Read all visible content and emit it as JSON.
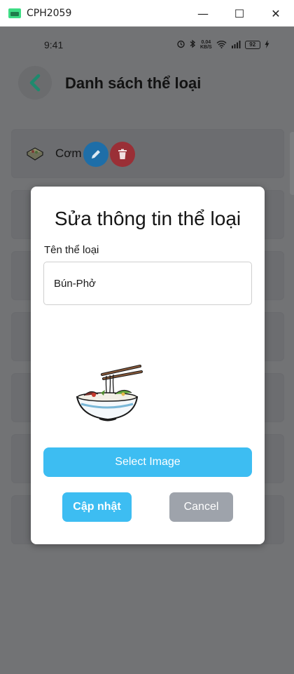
{
  "window": {
    "title": "CPH2059",
    "minimize_glyph": "—",
    "maximize_glyph": "☐",
    "close_glyph": "✕"
  },
  "status_bar": {
    "time": "9:41",
    "network_speed_value": "0.04",
    "network_speed_unit": "KB/S",
    "battery_level": "92",
    "icons": [
      "alarm-icon",
      "bluetooth-icon",
      "wifi-icon",
      "signal-icon",
      "battery-icon",
      "charging-icon"
    ]
  },
  "header": {
    "title": "Danh sách thể loại",
    "back_icon": "chevron-left-icon"
  },
  "list": {
    "items": [
      {
        "label": "Cơm"
      }
    ]
  },
  "modal": {
    "title": "Sửa thông tin thể loại",
    "field_label": "Tên thể loại",
    "input_value": "Bún-Phở",
    "select_image_label": "Select Image",
    "update_label": "Cập nhật",
    "cancel_label": "Cancel"
  },
  "colors": {
    "accent": "#3DBDF2",
    "cancel": "#9EA3AB",
    "edit": "#1E6EA8",
    "delete": "#9A2F36",
    "back_arrow": "#1E8A6E",
    "overlay": "#727375"
  }
}
